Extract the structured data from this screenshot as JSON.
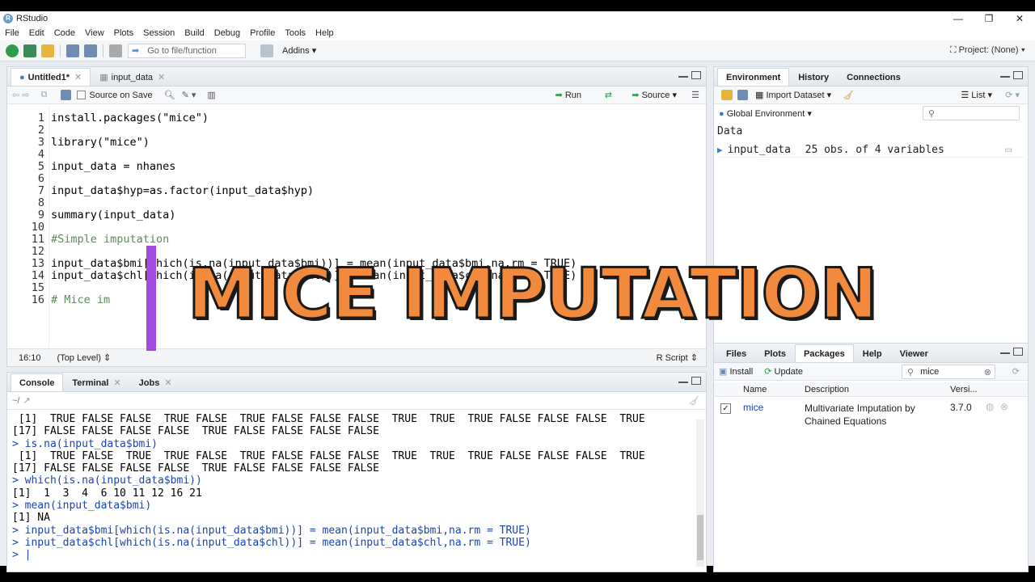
{
  "window": {
    "title": "RStudio",
    "controls": [
      "—",
      "❐",
      "✕"
    ]
  },
  "menu": [
    "File",
    "Edit",
    "Code",
    "View",
    "Plots",
    "Session",
    "Build",
    "Debug",
    "Profile",
    "Tools",
    "Help"
  ],
  "toolbar": {
    "goto_placeholder": "Go to file/function",
    "addins": "Addins",
    "project": "Project: (None)"
  },
  "editor": {
    "tabs": [
      {
        "label": "Untitled1*"
      },
      {
        "label": "input_data"
      }
    ],
    "source_on_save": "Source on Save",
    "run": "Run",
    "source": "Source",
    "lines": [
      "install.packages(\"mice\")",
      "",
      "library(\"mice\")",
      "",
      "input_data = nhanes",
      "",
      "input_data$hyp=as.factor(input_data$hyp)",
      "",
      "summary(input_data)",
      "",
      "#Simple imputation",
      "",
      "input_data$bmi[which(is.na(input_data$bmi))] = mean(input_data$bmi,na.rm = TRUE)",
      "input_data$chl[which(is.na(input_data$chl))] = mean(input_data$chl,na.rm = TRUE)",
      "",
      "# Mice im"
    ],
    "line_numbers": [
      "1",
      "2",
      "3",
      "4",
      "5",
      "6",
      "7",
      "8",
      "9",
      "10",
      "11",
      "12",
      "13",
      "14",
      "15",
      "16"
    ],
    "cursor": "16:10",
    "scope": "(Top Level)",
    "filetype": "R Script"
  },
  "overlay_text": "MICE IMPUTATION",
  "console": {
    "tabs": [
      "Console",
      "Terminal",
      "Jobs"
    ],
    "path": "~/",
    "lines": [
      {
        "t": "out",
        "s": " [1]  TRUE FALSE FALSE  TRUE FALSE  TRUE FALSE FALSE FALSE  TRUE  TRUE  TRUE FALSE FALSE FALSE  TRUE"
      },
      {
        "t": "out",
        "s": "[17] FALSE FALSE FALSE FALSE  TRUE FALSE FALSE FALSE FALSE"
      },
      {
        "t": "cmd",
        "s": "> is.na(input_data$bmi)"
      },
      {
        "t": "out",
        "s": " [1]  TRUE FALSE  TRUE  TRUE FALSE  TRUE FALSE FALSE FALSE  TRUE  TRUE  TRUE FALSE FALSE FALSE  TRUE"
      },
      {
        "t": "out",
        "s": "[17] FALSE FALSE FALSE FALSE  TRUE FALSE FALSE FALSE FALSE"
      },
      {
        "t": "cmd",
        "s": "> which(is.na(input_data$bmi))"
      },
      {
        "t": "out",
        "s": "[1]  1  3  4  6 10 11 12 16 21"
      },
      {
        "t": "cmd",
        "s": "> mean(input_data$bmi)"
      },
      {
        "t": "out",
        "s": "[1] NA"
      },
      {
        "t": "cmd",
        "s": "> input_data$bmi[which(is.na(input_data$bmi))] = mean(input_data$bmi,na.rm = TRUE)"
      },
      {
        "t": "cmd",
        "s": "> input_data$chl[which(is.na(input_data$chl))] = mean(input_data$chl,na.rm = TRUE)"
      },
      {
        "t": "cmd",
        "s": "> |"
      }
    ]
  },
  "environment": {
    "tabs": [
      "Environment",
      "History",
      "Connections"
    ],
    "import_dataset": "Import Dataset",
    "list_view": "List",
    "scope": "Global Environment",
    "section": "Data",
    "rows": [
      {
        "name": "input_data",
        "value": "25 obs. of 4 variables"
      }
    ]
  },
  "files": {
    "tabs": [
      "Files",
      "Plots",
      "Packages",
      "Help",
      "Viewer"
    ],
    "install": "Install",
    "update": "Update",
    "search_value": "mice",
    "columns": [
      "Name",
      "Description",
      "Versi..."
    ],
    "packages": [
      {
        "name": "mice",
        "description": "Multivariate Imputation by Chained Equations",
        "version": "3.7.0"
      }
    ]
  },
  "colors": {
    "overlay": "#f28a3e",
    "cursor_bar": "#a24be0",
    "console_cmd": "#1b43b5"
  }
}
